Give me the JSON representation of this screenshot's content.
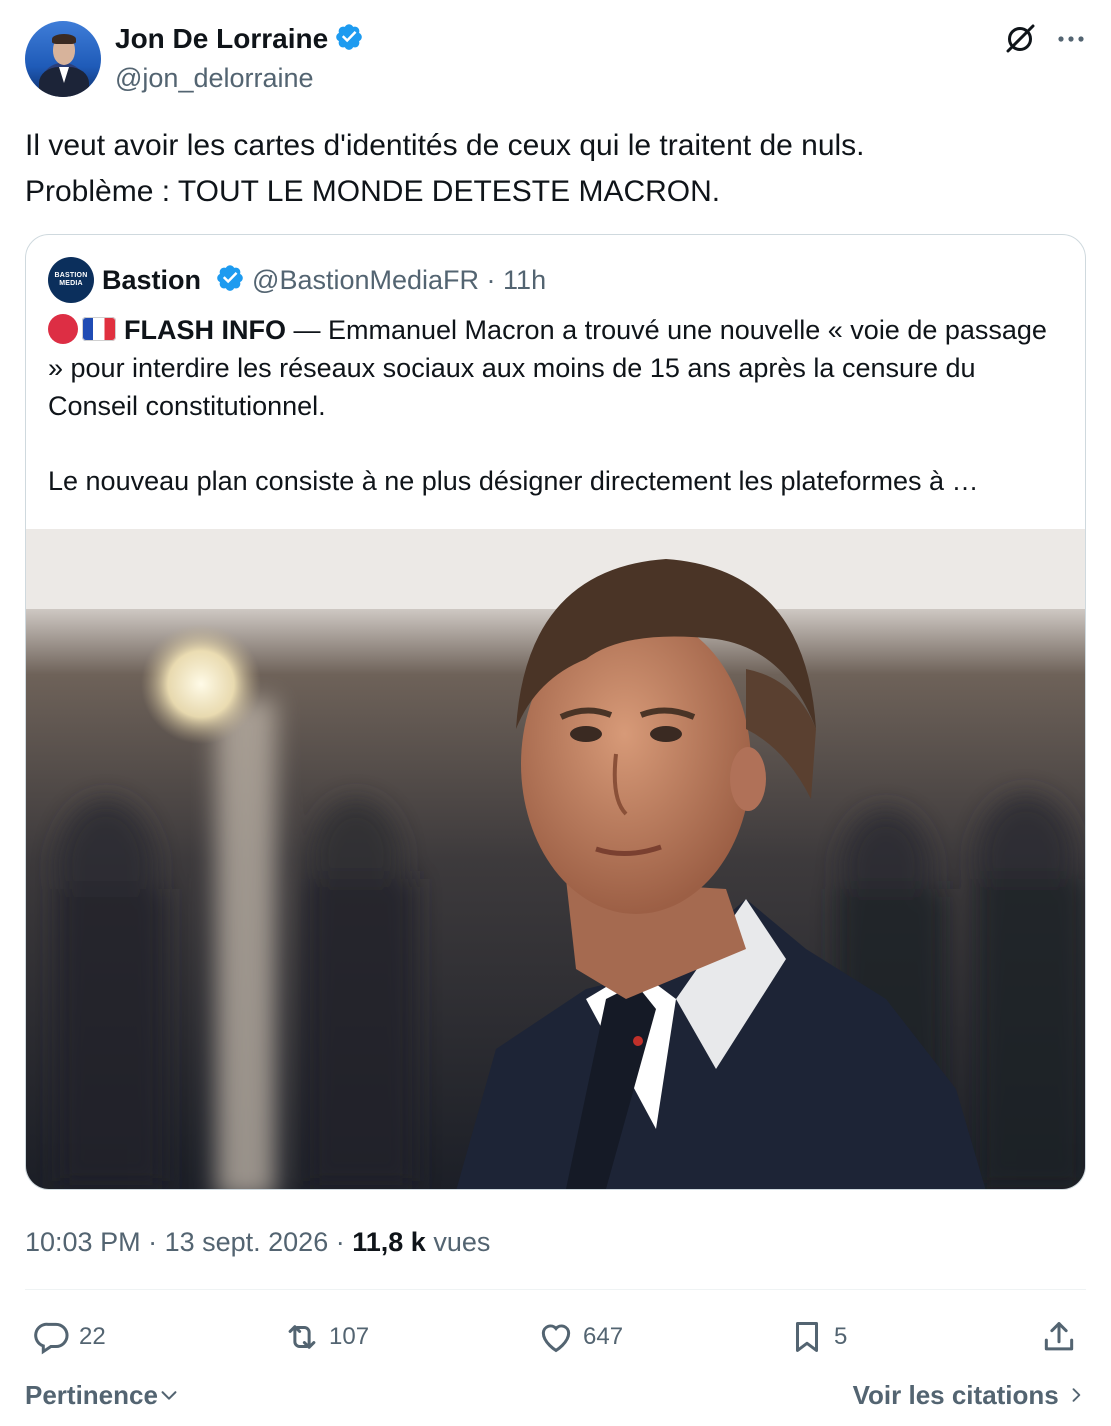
{
  "author": {
    "name": "Jon De Lorraine",
    "handle": "@jon_delorraine",
    "verified": true
  },
  "tweet": {
    "text": "Il veut avoir les cartes d'identités de ceux qui le traitent de nuls.\nProblème : TOUT LE MONDE DETESTE MACRON."
  },
  "quote": {
    "avatar_text": "BASTION MEDIA",
    "name": "Bastion",
    "handle": "@BastionMediaFR",
    "separator": " · ",
    "time": "11h",
    "flash_label": "FLASH INFO",
    "line1_rest": " — Emmanuel Macron a trouvé une nouvelle « voie de passage » pour interdire les réseaux sociaux aux moins de 15 ans après la censure du Conseil constitutionnel.",
    "line2": "Le nouveau plan consiste à ne plus désigner directement les plateformes à …",
    "image_alt": "Portrait d'Emmanuel Macron en costume sombre devant des gardes flous"
  },
  "meta": {
    "time": "10:03 PM",
    "separator": " · ",
    "date": "13 sept. 2026",
    "views_count": "11,8 k",
    "views_label": "vues"
  },
  "actions": {
    "replies": "22",
    "reposts": "107",
    "likes": "647",
    "bookmarks": "5"
  },
  "footer": {
    "sort_label": "Pertinence",
    "quotes_label": "Voir les citations"
  },
  "colors": {
    "text": "#0f1419",
    "secondary": "#536471",
    "verified": "#1d9bf0",
    "border": "#cfd9de"
  }
}
